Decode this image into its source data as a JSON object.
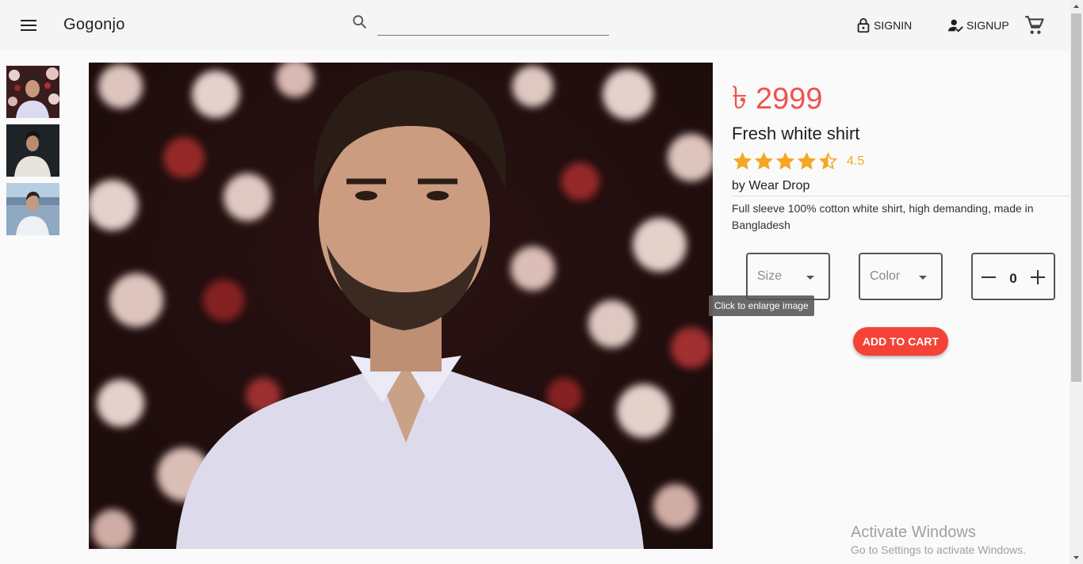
{
  "header": {
    "brand": "Gogonjo",
    "search": {
      "value": "",
      "placeholder": ""
    },
    "signin_label": "SIGNIN",
    "signup_label": "SIGNUP"
  },
  "product": {
    "currency_symbol": "৳",
    "price": "2999",
    "title": "Fresh white shirt",
    "rating": 4.5,
    "rating_label": "4.5",
    "by_prefix": "by",
    "brand": "Wear Drop",
    "description": "Full sleeve 100% cotton white shirt, high demanding, made in Bangladesh",
    "size_label": "Size",
    "color_label": "Color",
    "quantity": "0",
    "add_to_cart_label": "ADD TO CART",
    "tooltip": "Click to enlarge image"
  },
  "thumbnails": [
    {
      "name": "thumbnail-1"
    },
    {
      "name": "thumbnail-2"
    },
    {
      "name": "thumbnail-3"
    }
  ],
  "watermark": {
    "line1": "Activate Windows",
    "line2": "Go to Settings to activate Windows."
  },
  "colors": {
    "price": "#ef5350",
    "star": "#f6a623",
    "add_to_cart": "#f44336",
    "appbar": "#f5f5f5"
  }
}
